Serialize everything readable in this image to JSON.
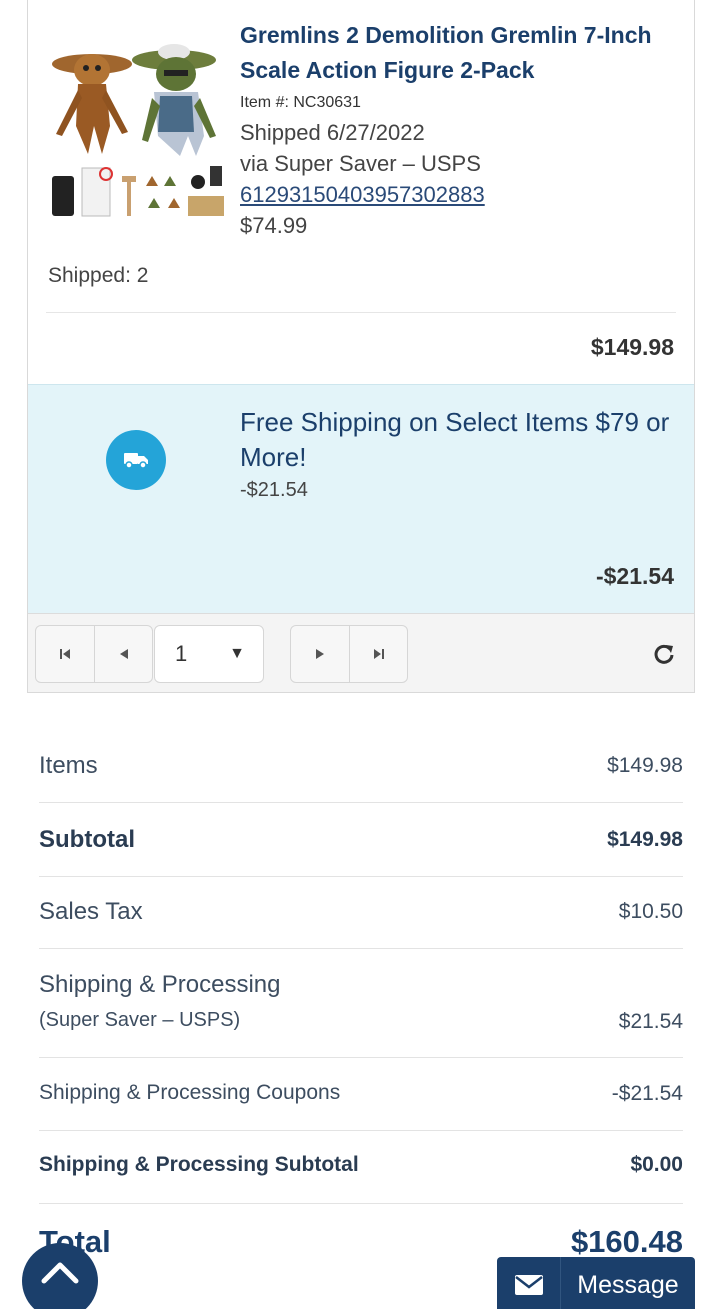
{
  "colors": {
    "brand_navy": "#1b3f6b",
    "promo_bg": "#e3f4f9",
    "promo_badge": "#24a4d8",
    "link": "#2a4a78"
  },
  "product": {
    "image_icon": "product-photo",
    "title": "Gremlins 2 Demolition Gremlin 7-Inch Scale Action Figure 2-Pack",
    "item_number": "Item #: NC30631",
    "shipped_date": "Shipped 6/27/2022",
    "shipped_via": "via Super Saver – USPS",
    "tracking_number": "61293150403957302883",
    "unit_price": "$74.99",
    "shipped_qty": "Shipped: 2",
    "line_total": "$149.98"
  },
  "promo": {
    "icon": "truck-icon",
    "title": "Free Shipping on Select Items $79 or More!",
    "amount": "-$21.54",
    "total": "-$21.54"
  },
  "pager": {
    "current_page": "1",
    "icons": [
      "first-page-icon",
      "prev-page-icon",
      "next-page-icon",
      "last-page-icon",
      "refresh-icon"
    ]
  },
  "summary": {
    "items_label": "Items",
    "items_value": "$149.98",
    "subtotal_label": "Subtotal",
    "subtotal_value": "$149.98",
    "tax_label": "Sales Tax",
    "tax_value": "$10.50",
    "shipping_label": "Shipping & Processing",
    "shipping_note": "(Super Saver – USPS)",
    "shipping_value": "$21.54",
    "coupons_label": "Shipping & Processing Coupons",
    "coupons_value": "-$21.54",
    "ship_subtotal_label": "Shipping & Processing Subtotal",
    "ship_subtotal_value": "$0.00",
    "total_label": "Total",
    "total_value": "$160.48"
  },
  "floating": {
    "scroll_top_icon": "chevron-up-icon",
    "message_icon": "envelope-icon",
    "message_label": "Message"
  }
}
